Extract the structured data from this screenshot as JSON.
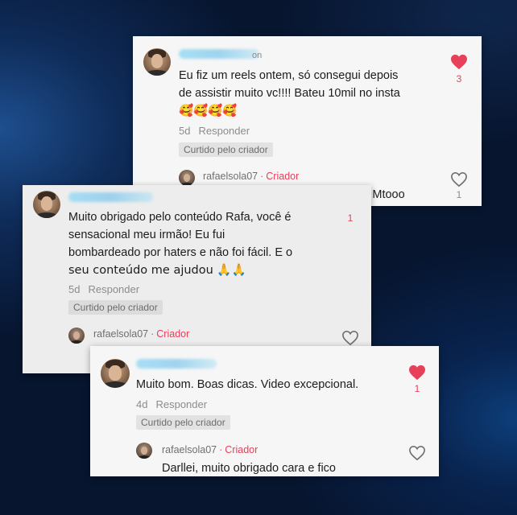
{
  "colors": {
    "accent_red": "#e6405a",
    "card_bg": "#f6f6f6",
    "meta_gray": "#8c8c8c"
  },
  "comments": [
    {
      "username_suffix": "on",
      "text_lines": [
        "Eu fiz um reels ontem, só consegui depois",
        "de assistir muito vc!!!! Bateu 10mil no insta"
      ],
      "emoji_line": "🥰🥰🥰🥰",
      "time": "5d",
      "reply_label": "Responder",
      "liked_by_creator": "Curtido pelo criador",
      "like_icon": "heart-filled-icon",
      "like_count": "3",
      "reply": {
        "username": "rafaelsola07",
        "separator": "·",
        "badge": "Criador",
        "text": "Fernando, q noticia espetacular. Mtooo",
        "like_icon": "heart-outline-icon",
        "like_count": "1"
      }
    },
    {
      "text_lines": [
        "Muito obrigado pelo conteúdo Rafa, você é",
        "sensacional meu irmão! Eu fui",
        "bombardeado por haters e não foi fácil. E o",
        "seu conteúdo me ajudou 🙏🙏"
      ],
      "time": "5d",
      "reply_label": "Responder",
      "liked_by_creator": "Curtido pelo criador",
      "like_count": "1",
      "reply": {
        "username": "rafaelsola07",
        "separator": "·",
        "badge": "Criador",
        "like_icon": "heart-outline-icon"
      }
    },
    {
      "text": "Muito bom. Boas dicas. Video excepcional.",
      "time": "4d",
      "reply_label": "Responder",
      "liked_by_creator": "Curtido pelo criador",
      "like_icon": "heart-filled-icon",
      "like_count": "1",
      "reply": {
        "username": "rafaelsola07",
        "separator": "·",
        "badge": "Criador",
        "text": "Darllei, muito obrigado cara e fico",
        "like_icon": "heart-outline-icon"
      }
    }
  ]
}
